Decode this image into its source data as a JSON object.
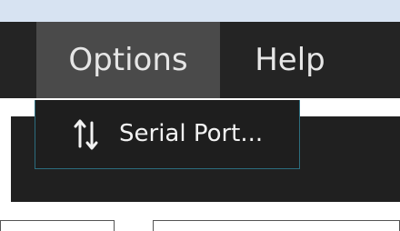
{
  "menubar": {
    "items": [
      {
        "label": "Options"
      },
      {
        "label": "Help"
      }
    ]
  },
  "dropdown": {
    "items": [
      {
        "label": "Serial Port...",
        "icon": "swap-arrows-icon"
      }
    ]
  },
  "colors": {
    "menubar_bg": "#242424",
    "active_menu_bg": "#4a4a4a",
    "dropdown_border": "#2c6d7e",
    "text": "#f2f2f2"
  }
}
